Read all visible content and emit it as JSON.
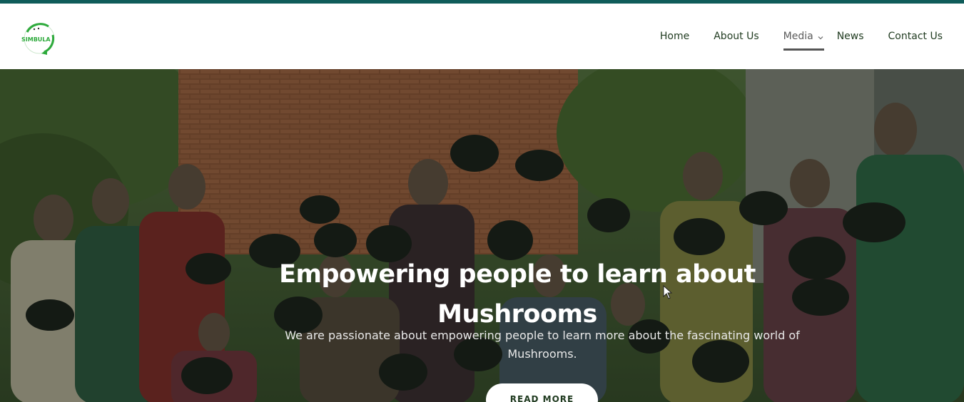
{
  "brand": {
    "logo_text": "SIMBULA",
    "accent_color": "#0f5c5a",
    "logo_green": "#2eaa3c"
  },
  "nav": {
    "items": [
      {
        "label": "Home"
      },
      {
        "label": "About Us"
      },
      {
        "label": "Media",
        "has_dropdown": true,
        "active": true
      },
      {
        "label": "News"
      },
      {
        "label": "Contact Us"
      }
    ]
  },
  "hero": {
    "title_line1": "Empowering people to learn about",
    "title_line2": "Mushrooms",
    "subtitle_line1": "We are passionate about empowering people to learn more about the fascinating world of",
    "subtitle_line2": "Mushrooms.",
    "button_label": "READ MORE",
    "image_subject": "group-photo-people-holding-mushroom-bags"
  }
}
